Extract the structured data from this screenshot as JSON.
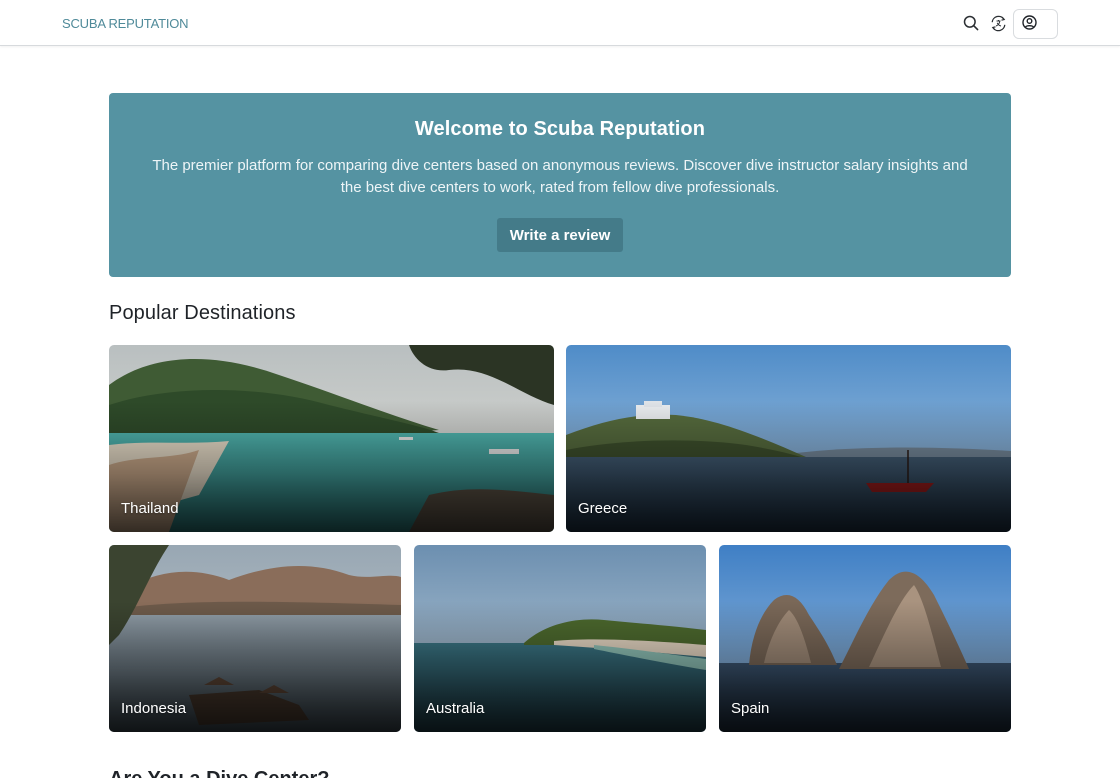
{
  "header": {
    "brand": "SCUBA REPUTATION",
    "icons": [
      "search-icon",
      "language-icon",
      "account-icon"
    ]
  },
  "hero": {
    "title": "Welcome to Scuba Reputation",
    "description": "The premier platform for comparing dive centers based on anonymous reviews. Discover dive instructor salary insights and the best dive centers to work, rated from fellow dive professionals.",
    "cta_label": "Write a review"
  },
  "destinations": {
    "title": "Popular Destinations",
    "items": [
      {
        "label": "Thailand"
      },
      {
        "label": "Greece"
      },
      {
        "label": "Indonesia"
      },
      {
        "label": "Australia"
      },
      {
        "label": "Spain"
      }
    ]
  },
  "next_section": {
    "title": "Are You a Dive Center?"
  },
  "colors": {
    "brand": "#4f8a99",
    "hero_bg": "#5593a2",
    "hero_button": "#447b89"
  }
}
